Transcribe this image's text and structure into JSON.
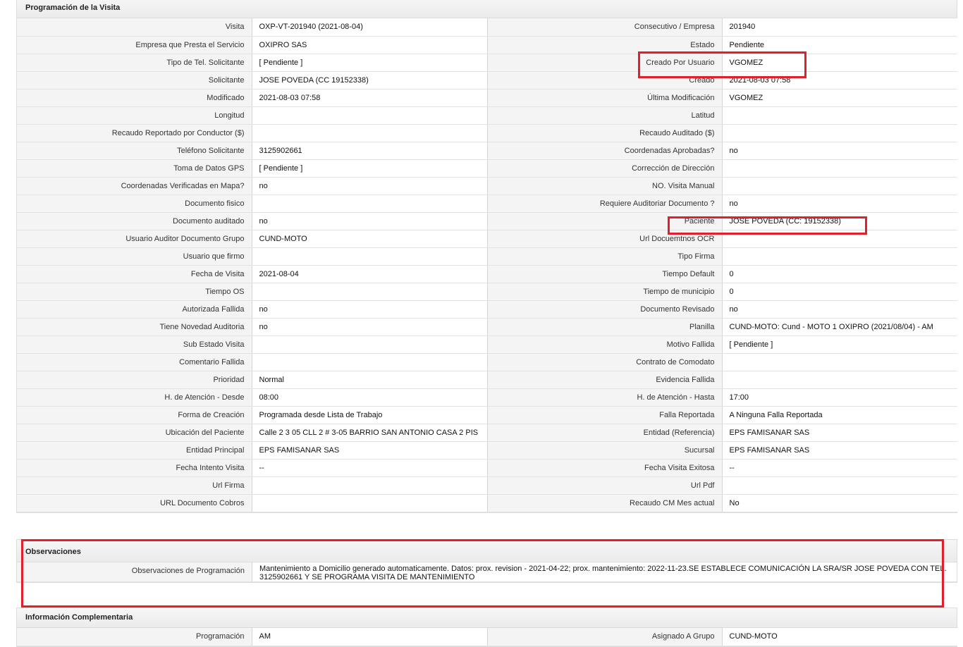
{
  "programacion": {
    "title": "Programación de la Visita",
    "rows": [
      {
        "l1": "Visita",
        "v1": "OXP-VT-201940 (2021-08-04)",
        "l2": "Consecutivo / Empresa",
        "v2": "201940"
      },
      {
        "l1": "Empresa que Presta el Servicio",
        "v1": "OXIPRO SAS",
        "l2": "Estado",
        "v2": "Pendiente"
      },
      {
        "l1": "Tipo de Tel. Solicitante",
        "v1": "[ Pendiente ]",
        "l2": "Creado Por Usuario",
        "v2": "VGOMEZ"
      },
      {
        "l1": "Solicitante",
        "v1": "JOSE POVEDA (CC 19152338)",
        "l2": "Creado",
        "v2": "2021-08-03 07:58"
      },
      {
        "l1": "Modificado",
        "v1": "2021-08-03 07:58",
        "l2": "Última Modificación",
        "v2": " VGOMEZ"
      },
      {
        "l1": "Longitud",
        "v1": "",
        "l2": "Latitud",
        "v2": ""
      },
      {
        "l1": "Recaudo Reportado por Conductor ($)",
        "v1": "",
        "l2": "Recaudo Auditado ($)",
        "v2": ""
      },
      {
        "l1": "Teléfono Solicitante",
        "v1": "3125902661",
        "l2": "Coordenadas Aprobadas?",
        "v2": " no"
      },
      {
        "l1": "Toma de Datos GPS",
        "v1": "[ Pendiente ]",
        "l2": "Corrección de Dirección",
        "v2": ""
      },
      {
        "l1": "Coordenadas Verificadas en Mapa?",
        "v1": " no",
        "l2": "NO. Visita Manual",
        "v2": ""
      },
      {
        "l1": "Documento fisico",
        "v1": "",
        "l2": "Requiere Auditoriar Documento ?",
        "v2": " no"
      },
      {
        "l1": "Documento auditado",
        "v1": " no",
        "l2": "Paciente",
        "v2": "JOSE POVEDA (CC: 19152338)"
      },
      {
        "l1": "Usuario Auditor Documento Grupo",
        "v1": "CUND-MOTO",
        "l2": "Url Docuemtnos OCR",
        "v2": ""
      },
      {
        "l1": "Usuario que firmo",
        "v1": "",
        "l2": "Tipo Firma",
        "v2": ""
      },
      {
        "l1": "Fecha de Visita",
        "v1": " 2021-08-04",
        "l2": "Tiempo Default",
        "v2": "0"
      },
      {
        "l1": "Tiempo OS",
        "v1": "",
        "l2": "Tiempo de municipio",
        "v2": "0"
      },
      {
        "l1": "Autorizada Fallida",
        "v1": " no",
        "l2": "Documento Revisado",
        "v2": " no"
      },
      {
        "l1": "Tiene Novedad Auditoria",
        "v1": " no",
        "l2": "Planilla",
        "v2": "CUND-MOTO: Cund - MOTO 1 OXIPRO (2021/08/04) - AM"
      },
      {
        "l1": "Sub Estado Visita",
        "v1": "",
        "l2": "Motivo Fallida",
        "v2": "[ Pendiente ]"
      },
      {
        "l1": "Comentario Fallida",
        "v1": "",
        "l2": "Contrato de Comodato",
        "v2": ""
      },
      {
        "l1": "Prioridad",
        "v1": "Normal",
        "l2": "Evidencia Fallida",
        "v2": ""
      },
      {
        "l1": "H. de Atención - Desde",
        "v1": "08:00",
        "l2": "H. de Atención - Hasta",
        "v2": "17:00"
      },
      {
        "l1": "Forma de Creación",
        "v1": "Programada desde Lista de Trabajo",
        "l2": "Falla Reportada",
        "v2": "A Ninguna Falla Reportada"
      },
      {
        "l1": "Ubicación del Paciente",
        "v1": "Calle 2 3 05 CLL 2 # 3-05 BARRIO SAN ANTONIO CASA 2 PIS",
        "l2": "Entidad (Referencia)",
        "v2": "EPS FAMISANAR SAS"
      },
      {
        "l1": "Entidad Principal",
        "v1": "EPS FAMISANAR SAS",
        "l2": "Sucursal",
        "v2": "EPS FAMISANAR SAS"
      },
      {
        "l1": "Fecha Intento Visita",
        "v1": " --",
        "l2": "Fecha Visita Exitosa",
        "v2": " --"
      },
      {
        "l1": "Url Firma",
        "v1": "",
        "l2": "Url Pdf",
        "v2": ""
      },
      {
        "l1": "URL Documento Cobros",
        "v1": "",
        "l2": "Recaudo CM Mes actual",
        "v2": "No"
      }
    ]
  },
  "observaciones": {
    "title": "Observaciones",
    "label": "Observaciones de Programación",
    "value": "Mantenimiento a Domicilio generado automaticamente. Datos: prox. revision - 2021-04-22; prox. mantenimiento: 2022-11-23.SE ESTABLECE COMUNICACIÓN LA SRA/SR JOSE POVEDA CON TEL. 3125902661 Y SE PROGRAMA VISITA DE MANTENIMIENTO"
  },
  "complementaria": {
    "title": "Información Complementaria",
    "rows": [
      {
        "l1": "Programación",
        "v1": "AM",
        "l2": "Asignado A Grupo",
        "v2": "CUND-MOTO"
      }
    ]
  },
  "colors": {
    "highlight": "#e0202a",
    "header_bg": "#ebebeb",
    "label_bg": "#f4f4f4"
  }
}
